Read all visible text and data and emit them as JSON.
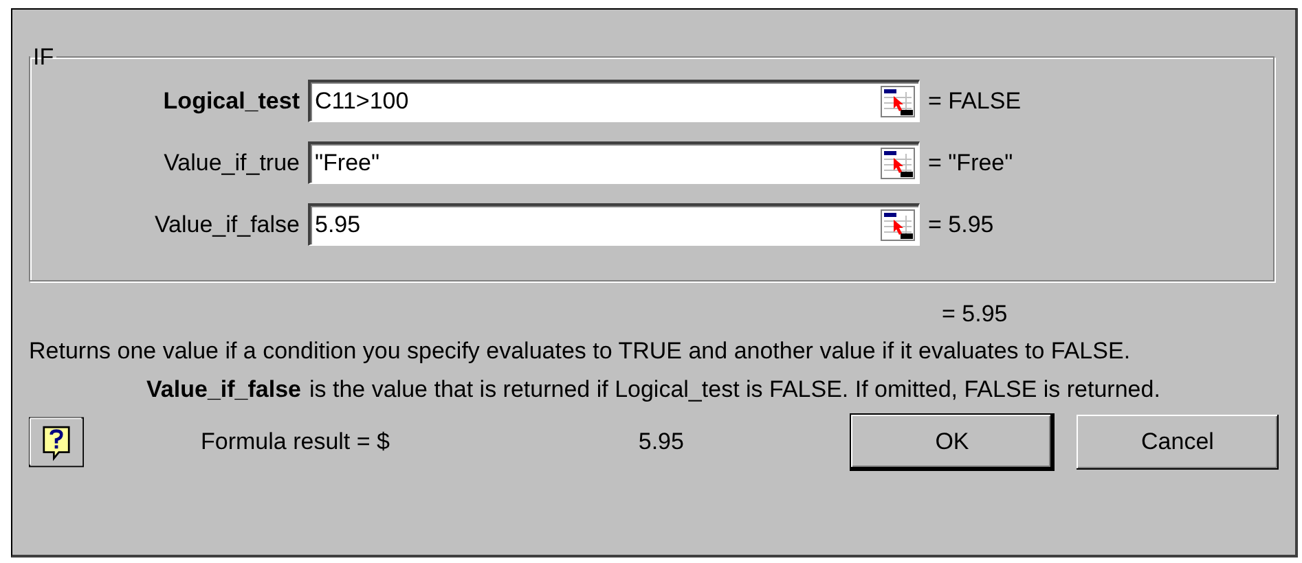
{
  "group": {
    "title": "IF"
  },
  "args": [
    {
      "label": "Logical_test",
      "value": "C11>100",
      "result": "= FALSE",
      "active": true
    },
    {
      "label": "Value_if_true",
      "value": "\"Free\"",
      "result": "= \"Free\"",
      "active": false
    },
    {
      "label": "Value_if_false",
      "value": "5.95",
      "result": "= 5.95",
      "active": false
    }
  ],
  "overall_result": "= 5.95",
  "description": "Returns one value if a condition you specify evaluates to TRUE and another value if it evaluates to FALSE.",
  "arg_help": {
    "name": "Value_if_false",
    "text": "is the value that is returned if Logical_test is FALSE. If omitted, FALSE is returned."
  },
  "formula_result": {
    "label": "Formula result = $",
    "value": "5.95"
  },
  "buttons": [
    {
      "label": "OK",
      "default": true
    },
    {
      "label": "Cancel",
      "default": false
    }
  ]
}
